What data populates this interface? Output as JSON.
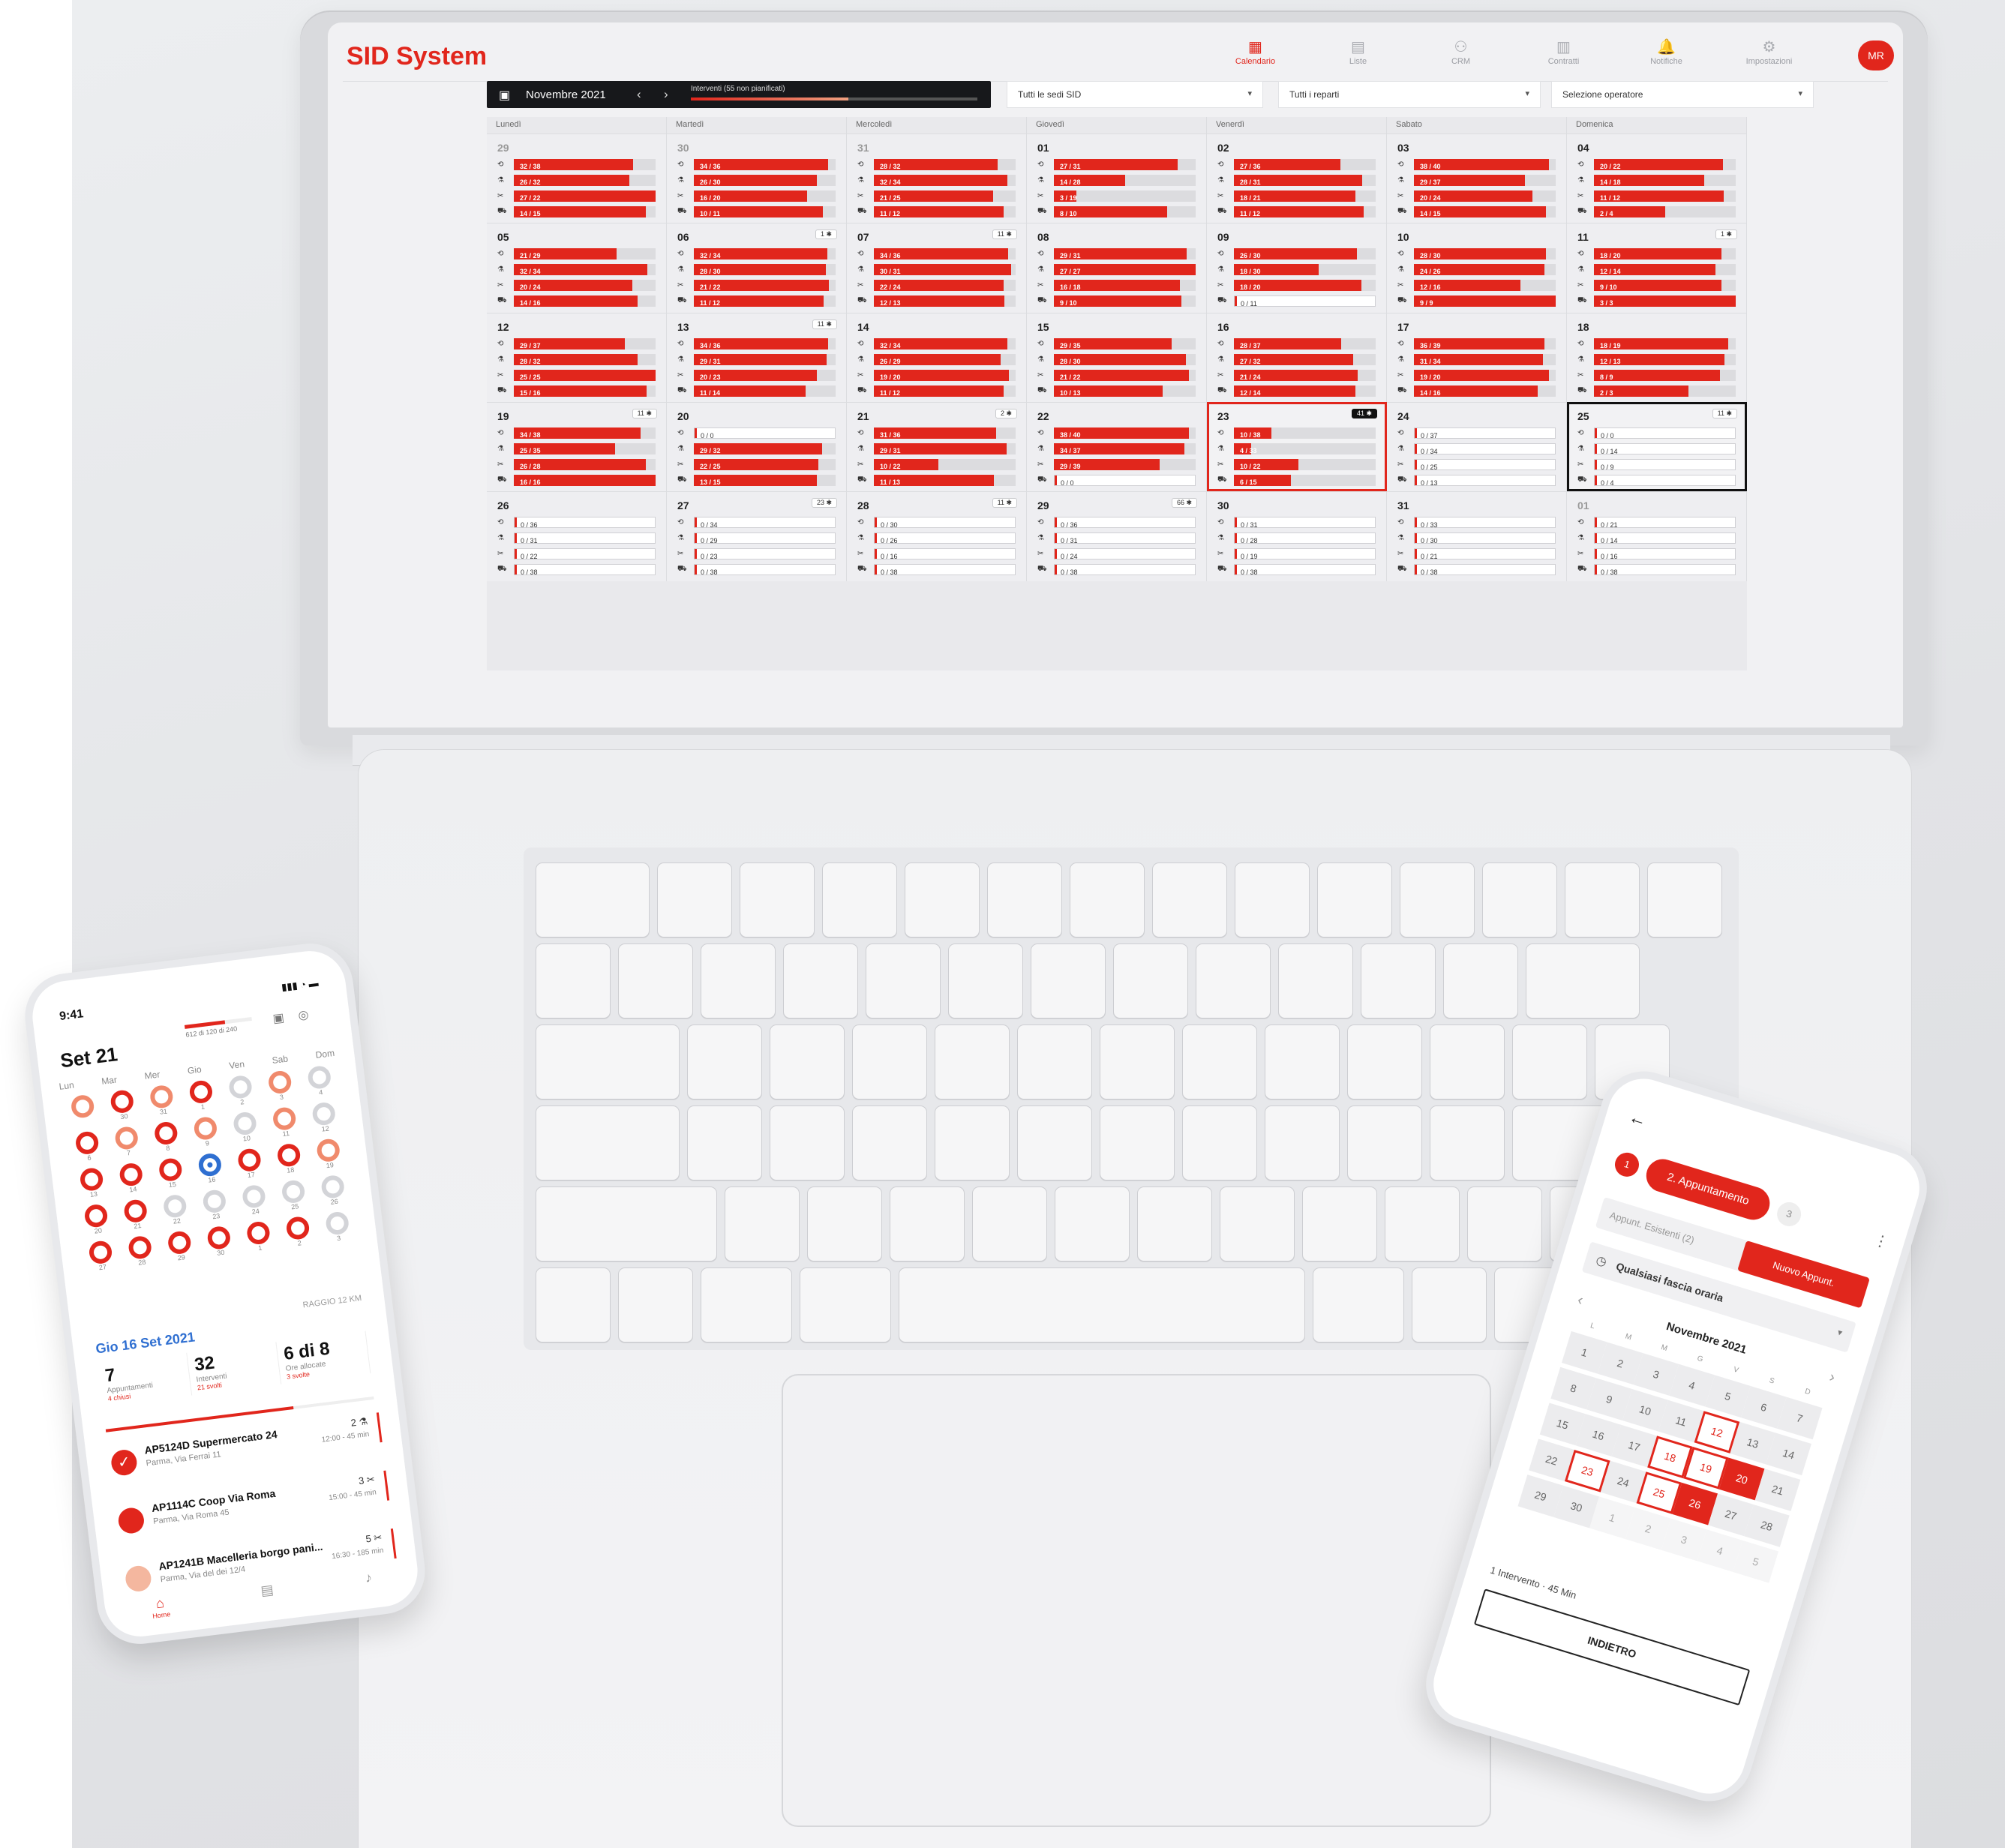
{
  "app": {
    "brand": "SID System",
    "avatar": "MR"
  },
  "nav": [
    {
      "label": "Calendario",
      "icon": "calendar-icon",
      "glyph": "▦",
      "active": true
    },
    {
      "label": "Liste",
      "icon": "list-icon",
      "glyph": "▤",
      "active": false
    },
    {
      "label": "CRM",
      "icon": "crm-icon",
      "glyph": "⚇",
      "active": false
    },
    {
      "label": "Contratti",
      "icon": "contract-icon",
      "glyph": "▥",
      "active": false
    },
    {
      "label": "Notifiche",
      "icon": "bell-icon",
      "glyph": "🔔",
      "active": false
    },
    {
      "label": "Impostazioni",
      "icon": "gear-icon",
      "glyph": "⚙",
      "active": false
    }
  ],
  "toolbar": {
    "month": "Novembre 2021",
    "progress_label": "Interventi (55 non pianificati)",
    "progress": 0.55,
    "filter_sedi": "Tutti le sedi SID",
    "filter_reparti": "Tutti i reparti",
    "filter_operatore": "Selezione operatore"
  },
  "weekdays": [
    "Lunedì",
    "Martedì",
    "Mercoledì",
    "Giovedì",
    "Venerdì",
    "Sabato",
    "Domenica"
  ],
  "row_icons": [
    "⟲",
    "⚗",
    "✂",
    "⛟"
  ],
  "calendar_days": [
    {
      "n": "29",
      "other": true,
      "rows": [
        "32 / 38",
        "26 / 32",
        "27 / 22",
        "14 / 15"
      ]
    },
    {
      "n": "30",
      "other": true,
      "rows": [
        "34 / 36",
        "26 / 30",
        "16 / 20",
        "10 / 11"
      ]
    },
    {
      "n": "31",
      "other": true,
      "rows": [
        "28 / 32",
        "32 / 34",
        "21 / 25",
        "11 / 12"
      ]
    },
    {
      "n": "01",
      "rows": [
        "27 / 31",
        "14 / 28",
        "3 / 19",
        "8 / 10"
      ]
    },
    {
      "n": "02",
      "rows": [
        "27 / 36",
        "28 / 31",
        "18 / 21",
        "11 / 12"
      ]
    },
    {
      "n": "03",
      "rows": [
        "38 / 40",
        "29 / 37",
        "20 / 24",
        "14 / 15"
      ]
    },
    {
      "n": "04",
      "rows": [
        "20 / 22",
        "14 / 18",
        "11 / 12",
        "2 / 4"
      ]
    },
    {
      "n": "05",
      "rows": [
        "21 / 29",
        "32 / 34",
        "20 / 24",
        "14 / 16"
      ]
    },
    {
      "n": "06",
      "badge": "1",
      "rows": [
        "32 / 34",
        "28 / 30",
        "21 / 22",
        "11 / 12"
      ]
    },
    {
      "n": "07",
      "badge": "11",
      "rows": [
        "34 / 36",
        "30 / 31",
        "22 / 24",
        "12 / 13"
      ]
    },
    {
      "n": "08",
      "rows": [
        "29 / 31",
        "27 / 27",
        "16 / 18",
        "9 / 10"
      ]
    },
    {
      "n": "09",
      "rows": [
        "26 / 30",
        "18 / 30",
        "18 / 20",
        "0 / 11"
      ]
    },
    {
      "n": "10",
      "rows": [
        "28 / 30",
        "24 / 26",
        "12 / 16",
        "9 / 9"
      ]
    },
    {
      "n": "11",
      "badge": "1",
      "rows": [
        "18 / 20",
        "12 / 14",
        "9 / 10",
        "3 / 3"
      ]
    },
    {
      "n": "12",
      "rows": [
        "29 / 37",
        "28 / 32",
        "25 / 25",
        "15 / 16"
      ]
    },
    {
      "n": "13",
      "badge": "11",
      "rows": [
        "34 / 36",
        "29 / 31",
        "20 / 23",
        "11 / 14"
      ]
    },
    {
      "n": "14",
      "rows": [
        "32 / 34",
        "26 / 29",
        "19 / 20",
        "11 / 12"
      ]
    },
    {
      "n": "15",
      "rows": [
        "29 / 35",
        "28 / 30",
        "21 / 22",
        "10 / 13"
      ]
    },
    {
      "n": "16",
      "rows": [
        "28 / 37",
        "27 / 32",
        "21 / 24",
        "12 / 14"
      ]
    },
    {
      "n": "17",
      "rows": [
        "36 / 39",
        "31 / 34",
        "19 / 20",
        "14 / 16"
      ]
    },
    {
      "n": "18",
      "rows": [
        "18 / 19",
        "12 / 13",
        "8 / 9",
        "2 / 3"
      ]
    },
    {
      "n": "19",
      "badge": "11",
      "rows": [
        "34 / 38",
        "25 / 35",
        "26 / 28",
        "16 / 16"
      ]
    },
    {
      "n": "20",
      "rows": [
        "0 / 0",
        "29 / 32",
        "22 / 25",
        "13 / 15"
      ]
    },
    {
      "n": "21",
      "badge": "2",
      "rows": [
        "31 / 36",
        "29 / 31",
        "10 / 22",
        "11 / 13"
      ]
    },
    {
      "n": "22",
      "rows": [
        "38 / 40",
        "34 / 37",
        "29 / 39",
        "0 / 0"
      ]
    },
    {
      "n": "23",
      "badge": "41",
      "current": true,
      "rows": [
        "10 / 38",
        "4 / 33",
        "10 / 22",
        "6 / 15"
      ]
    },
    {
      "n": "24",
      "rows": [
        "0 / 37",
        "0 / 34",
        "0 / 25",
        "0 / 13"
      ]
    },
    {
      "n": "25",
      "badge": "11",
      "selected": true,
      "rows": [
        "0 / 0",
        "0 / 14",
        "0 / 9",
        "0 / 4"
      ]
    },
    {
      "n": "26",
      "rows": [
        "0 / 36",
        "0 / 31",
        "0 / 22",
        "0 / 38"
      ]
    },
    {
      "n": "27",
      "badge": "23",
      "rows": [
        "0 / 34",
        "0 / 29",
        "0 / 23",
        "0 / 38"
      ]
    },
    {
      "n": "28",
      "badge": "11",
      "rows": [
        "0 / 30",
        "0 / 26",
        "0 / 16",
        "0 / 38"
      ]
    },
    {
      "n": "29",
      "badge": "66",
      "rows": [
        "0 / 36",
        "0 / 31",
        "0 / 24",
        "0 / 38"
      ]
    },
    {
      "n": "30",
      "rows": [
        "0 / 31",
        "0 / 28",
        "0 / 19",
        "0 / 38"
      ]
    },
    {
      "n": "31",
      "rows": [
        "0 / 33",
        "0 / 30",
        "0 / 21",
        "0 / 38"
      ]
    },
    {
      "n": "01",
      "other": true,
      "rows": [
        "0 / 21",
        "0 / 14",
        "0 / 16",
        "0 / 38"
      ]
    }
  ],
  "phone_left": {
    "time": "9:41",
    "status": "▮▮▮ ◔ ▬",
    "title": "Set 21",
    "counter": "612 di 120 di 240",
    "weekdays": [
      "Lun",
      "Mar",
      "Mer",
      "Gio",
      "Ven",
      "Sab",
      "Dom"
    ],
    "days": [
      {
        "d": "",
        "k": "med"
      },
      {
        "d": "30",
        "k": "red"
      },
      {
        "d": "31",
        "k": "med"
      },
      {
        "d": "1",
        "k": "red"
      },
      {
        "d": "2",
        "k": "light"
      },
      {
        "d": "3",
        "k": "med"
      },
      {
        "d": "4",
        "k": "light"
      },
      {
        "d": "6",
        "k": "red"
      },
      {
        "d": "7",
        "k": "med"
      },
      {
        "d": "8",
        "k": "red"
      },
      {
        "d": "9",
        "k": "med"
      },
      {
        "d": "10",
        "k": "light"
      },
      {
        "d": "11",
        "k": "med"
      },
      {
        "d": "12",
        "k": "light"
      },
      {
        "d": "13",
        "k": "red"
      },
      {
        "d": "14",
        "k": "red"
      },
      {
        "d": "15",
        "k": "red"
      },
      {
        "d": "16",
        "k": "today"
      },
      {
        "d": "17",
        "k": "red"
      },
      {
        "d": "18",
        "k": "red"
      },
      {
        "d": "19",
        "k": "med"
      },
      {
        "d": "20",
        "k": "red"
      },
      {
        "d": "21",
        "k": "red"
      },
      {
        "d": "22",
        "k": "light"
      },
      {
        "d": "23",
        "k": "light"
      },
      {
        "d": "24",
        "k": "light"
      },
      {
        "d": "25",
        "k": "light"
      },
      {
        "d": "26",
        "k": "light"
      },
      {
        "d": "27",
        "k": "red"
      },
      {
        "d": "28",
        "k": "red"
      },
      {
        "d": "29",
        "k": "red"
      },
      {
        "d": "30",
        "k": "red"
      },
      {
        "d": "1",
        "k": "red"
      },
      {
        "d": "2",
        "k": "red"
      },
      {
        "d": "3",
        "k": "light"
      }
    ],
    "radius": "RAGGIO 12 KM",
    "date": "Gio 16 Set 2021",
    "stats": [
      {
        "big": "7",
        "small": "Appuntamenti",
        "sub": "4 chiusi"
      },
      {
        "big": "32",
        "small": "Interventi",
        "sub": "21 svolti"
      },
      {
        "big": "6 di 8",
        "small": "Ore allocate",
        "sub": "3 svolte"
      }
    ],
    "items": [
      {
        "name": "AP5124D Supermercato 24",
        "addr": "Parma, Via Ferrai 11",
        "cnt": "2 ⚗",
        "tm": "12:00 - 45 min",
        "state": "ok"
      },
      {
        "name": "AP1114C Coop Via Roma",
        "addr": "Parma, Via Roma 45",
        "cnt": "3 ✂",
        "tm": "15:00 - 45 min",
        "state": "red"
      },
      {
        "name": "AP1241B Macelleria borgo pani...",
        "addr": "Parma, Via del dei 12/4",
        "cnt": "5 ✂",
        "tm": "16:30 - 185 min",
        "state": "pale"
      }
    ],
    "tab_home": "Home"
  },
  "phone_right": {
    "step1": "1",
    "step2": "2. Appuntamento",
    "step3": "3",
    "existing": "Appunt. Esistenti (2)",
    "new_btn": "Nuovo Appunt.",
    "slot": "Qualsiasi fascia oraria",
    "month": "Novembre 2021",
    "weekdays": [
      "L",
      "M",
      "M",
      "G",
      "V",
      "S",
      "D"
    ],
    "days": [
      {
        "d": "1"
      },
      {
        "d": "2"
      },
      {
        "d": "3"
      },
      {
        "d": "4"
      },
      {
        "d": "5"
      },
      {
        "d": "6"
      },
      {
        "d": "7"
      },
      {
        "d": "8"
      },
      {
        "d": "9"
      },
      {
        "d": "10"
      },
      {
        "d": "11"
      },
      {
        "d": "12",
        "k": "hl"
      },
      {
        "d": "13"
      },
      {
        "d": "14"
      },
      {
        "d": "15"
      },
      {
        "d": "16"
      },
      {
        "d": "17"
      },
      {
        "d": "18",
        "k": "hl"
      },
      {
        "d": "19",
        "k": "hl"
      },
      {
        "d": "20",
        "k": "fill"
      },
      {
        "d": "21"
      },
      {
        "d": "22"
      },
      {
        "d": "23",
        "k": "hl"
      },
      {
        "d": "24"
      },
      {
        "d": "25",
        "k": "hl"
      },
      {
        "d": "26",
        "k": "fill"
      },
      {
        "d": "27"
      },
      {
        "d": "28"
      },
      {
        "d": "29"
      },
      {
        "d": "30"
      },
      {
        "d": "1",
        "k": "out"
      },
      {
        "d": "2",
        "k": "out"
      },
      {
        "d": "3",
        "k": "out"
      },
      {
        "d": "4",
        "k": "out"
      },
      {
        "d": "5",
        "k": "out"
      }
    ],
    "info": "1 Intervento · 45 Min",
    "back_btn": "INDIETRO"
  },
  "colors": {
    "accent": "#e1261c",
    "dark": "#17181b",
    "today": "#2f6fd1"
  }
}
